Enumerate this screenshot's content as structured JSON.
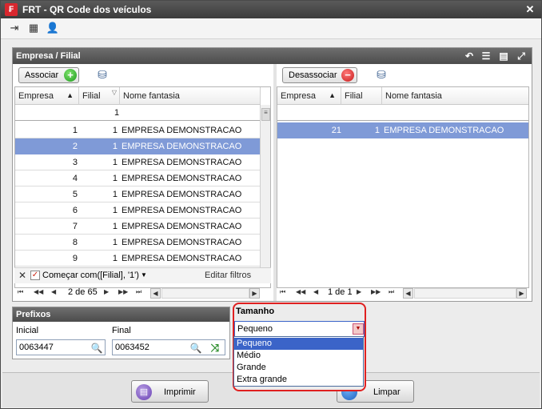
{
  "window": {
    "title": "FRT - QR Code dos veículos",
    "close_glyph": "✕"
  },
  "toolbar": {
    "icons": [
      "exit-icon",
      "card-icon",
      "user-icon"
    ]
  },
  "group": {
    "title": "Empresa / Filial",
    "header_icons": [
      "undo-icon",
      "list-icon",
      "columns-icon",
      "expand-icon"
    ]
  },
  "left": {
    "associate_label": "Associar",
    "columns": [
      "Empresa",
      "Filial",
      "Nome fantasia"
    ],
    "filter_row": {
      "filial": "1"
    },
    "rows": [
      {
        "empresa": "1",
        "filial": "1",
        "nome": "EMPRESA DEMONSTRACAO"
      },
      {
        "empresa": "2",
        "filial": "1",
        "nome": "EMPRESA DEMONSTRACAO"
      },
      {
        "empresa": "3",
        "filial": "1",
        "nome": "EMPRESA DEMONSTRACAO"
      },
      {
        "empresa": "4",
        "filial": "1",
        "nome": "EMPRESA DEMONSTRACAO"
      },
      {
        "empresa": "5",
        "filial": "1",
        "nome": "EMPRESA DEMONSTRACAO"
      },
      {
        "empresa": "6",
        "filial": "1",
        "nome": "EMPRESA DEMONSTRACAO"
      },
      {
        "empresa": "7",
        "filial": "1",
        "nome": "EMPRESA DEMONSTRACAO"
      },
      {
        "empresa": "8",
        "filial": "1",
        "nome": "EMPRESA DEMONSTRACAO"
      },
      {
        "empresa": "9",
        "filial": "1",
        "nome": "EMPRESA DEMONSTRACAO"
      }
    ],
    "selected_row": 1,
    "filter_text": "Começar com([Filial], '1')",
    "edit_filters": "Editar filtros",
    "pager": "2 de 65"
  },
  "right": {
    "disassociate_label": "Desassociar",
    "columns": [
      "Empresa",
      "Filial",
      "Nome fantasia"
    ],
    "rows": [
      {
        "empresa": "21",
        "filial": "1",
        "nome": "EMPRESA DEMONSTRACAO"
      }
    ],
    "pager": "1 de 1"
  },
  "prefixos": {
    "title": "Prefixos",
    "inicial_label": "Inicial",
    "inicial_value": "0063447",
    "final_label": "Final",
    "final_value": "0063452"
  },
  "tamanho": {
    "title": "Tamanho",
    "selected": "Pequeno",
    "options": [
      "Pequeno",
      "Médio",
      "Grande",
      "Extra grande"
    ]
  },
  "footer": {
    "print_label": "Imprimir",
    "clear_label": "Limpar"
  },
  "colors": {
    "highlight": "#e02020",
    "selection": "#7f9ad7",
    "dropdown_selection": "#3b64c8"
  }
}
